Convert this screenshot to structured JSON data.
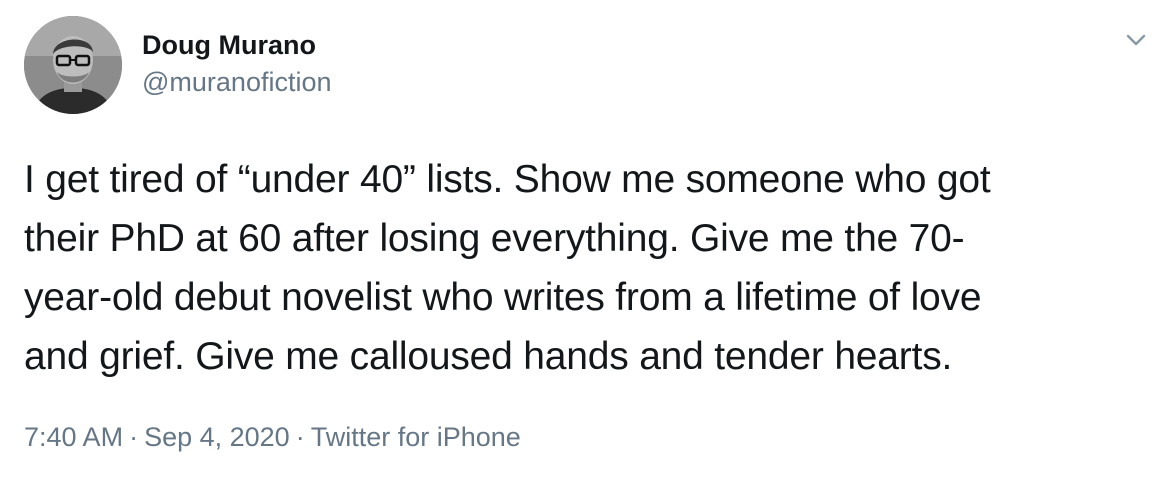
{
  "author": {
    "display_name": "Doug Murano",
    "handle": "@muranofiction",
    "avatar_icon": "person-portrait-icon"
  },
  "tweet": {
    "lines": [
      "I get tired of “under 40” lists. Show me someone who got",
      "their PhD at 60 after losing everything. Give me the 70-",
      "year-old debut novelist who writes from a lifetime of love",
      "and grief. Give me calloused hands and tender hearts."
    ]
  },
  "meta": {
    "time": "7:40 AM",
    "separator": "·",
    "date": "Sep 4, 2020",
    "source": "Twitter for iPhone"
  },
  "menu": {
    "icon": "chevron-down-icon"
  },
  "colors": {
    "text": "#14171a",
    "secondary": "#657786",
    "background": "#ffffff"
  }
}
